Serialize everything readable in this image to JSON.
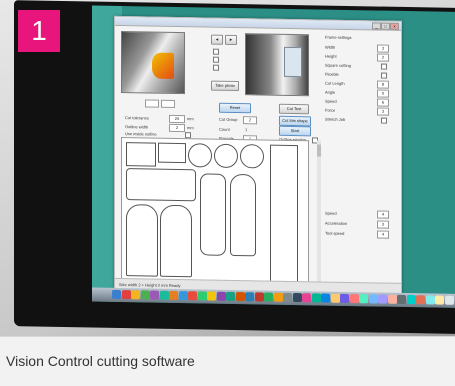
{
  "badge": {
    "number": "1",
    "color": "#e8157d"
  },
  "caption": {
    "text": "Vision Control cutting software"
  },
  "monitor": {
    "brand": "acer"
  },
  "app": {
    "buttons": {
      "prev_label": "◄",
      "next_label": "►",
      "take_photo_label": "Take photo",
      "reset_label": "Reset",
      "cut_test_label": "Cut Test",
      "cut_this_label": "Cut this shape",
      "start_label": "Start"
    },
    "left_controls": {
      "rows": [
        {
          "label": "Cut tolerance",
          "value": "20",
          "unit": "mm"
        },
        {
          "label": "Outline width",
          "value": "2",
          "unit": "mm"
        },
        {
          "label": "Use inside outline",
          "value": "",
          "unit": ""
        }
      ]
    },
    "mid_controls": {
      "rows": [
        {
          "label": "Cut Group",
          "value": "2"
        },
        {
          "label": "Count",
          "value": "1"
        },
        {
          "label": "Repeats",
          "value": "1"
        }
      ],
      "outline_label": "Outline rotation"
    },
    "right_panel": {
      "title": "Frame settings",
      "rows": [
        {
          "label": "Width",
          "value": "3"
        },
        {
          "label": "Height",
          "value": "2"
        },
        {
          "label": "Square cutting",
          "value": ""
        },
        {
          "label": "Flexible",
          "value": ""
        },
        {
          "label": "Cut Length",
          "value": "8"
        },
        {
          "label": "Angle",
          "value": "0"
        },
        {
          "label": "Speed",
          "value": "6"
        },
        {
          "label": "Force",
          "value": "3"
        },
        {
          "label": "Stretch Job",
          "value": ""
        }
      ],
      "lower_rows": [
        {
          "label": "Speed",
          "value": "4"
        },
        {
          "label": "Acceleration",
          "value": "3"
        },
        {
          "label": "Tool speed",
          "value": "4"
        }
      ]
    },
    "status_text": "Size width 2 + Height 2 mm  Ready"
  },
  "dock_colors": [
    "#3b7fd1",
    "#e23f3f",
    "#f2b420",
    "#4cb050",
    "#9b59b6",
    "#1abc9c",
    "#e67e22",
    "#3498db",
    "#e74c3c",
    "#2ecc71",
    "#f1c40f",
    "#8e44ad",
    "#16a085",
    "#d35400",
    "#2980b9",
    "#c0392b",
    "#27ae60",
    "#f39c12",
    "#7f8c8d",
    "#34495e",
    "#e84393",
    "#00b894",
    "#0984e3",
    "#fdcb6e",
    "#6c5ce7",
    "#ff7675",
    "#55efc4",
    "#74b9ff",
    "#a29bfe",
    "#fab1a0",
    "#636e72",
    "#00cec9",
    "#e17055",
    "#81ecec",
    "#ffeaa7",
    "#dfe6e9"
  ]
}
